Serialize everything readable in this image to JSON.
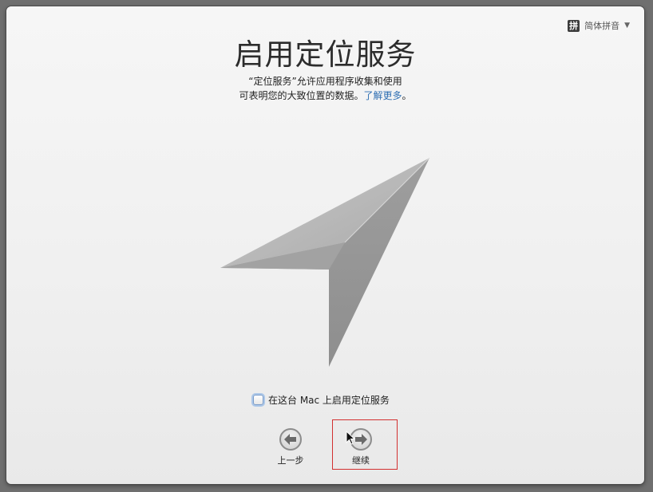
{
  "input_menu": {
    "icon_glyph": "拼",
    "label": "简体拼音",
    "chevron": "▼"
  },
  "page": {
    "title": "启用定位服务",
    "description_line1": "“定位服务”允许应用程序收集和使用",
    "description_line2": "可表明您的大致位置的数据。",
    "learn_more": "了解更多",
    "period": "。"
  },
  "checkbox": {
    "label": "在这台 Mac 上启用定位服务",
    "checked": false
  },
  "buttons": {
    "back_label": "上一步",
    "continue_label": "继续"
  },
  "icons": {
    "location": "location-arrow-icon",
    "back": "left-arrow-icon",
    "continue": "right-arrow-icon"
  },
  "colors": {
    "link": "#2f6fb3",
    "focus": "#d23030"
  }
}
